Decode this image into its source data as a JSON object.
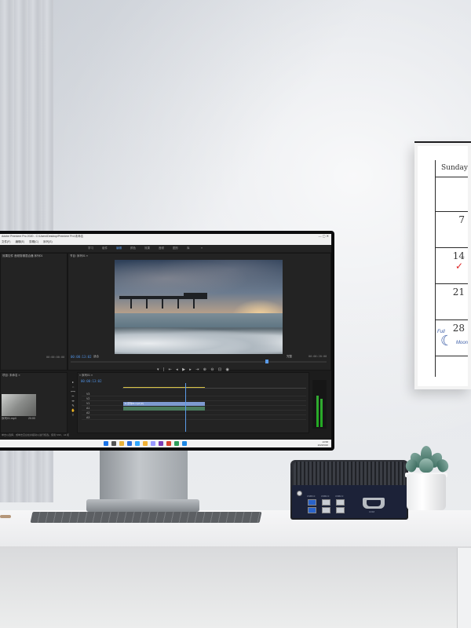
{
  "scene": {
    "description_tags": [
      "desk",
      "monitor",
      "mini-pc",
      "calendar",
      "plant"
    ]
  },
  "calendar": {
    "header": "Sunday",
    "days": [
      "7",
      "14",
      "21",
      "28"
    ],
    "note_text": "Full",
    "note_text2": "Moon"
  },
  "premiere": {
    "title": "Adobe Premiere Pro 2020 - C:\\Users\\Desktop\\Premiere Pro\\未命名",
    "menu": [
      "文件(F)",
      "编辑(E)",
      "剪辑(C)",
      "序列(S)",
      "标记(M)",
      "图形(G)",
      "窗口(W)",
      "帮助(H)"
    ],
    "workspaces": [
      "学习",
      "组件",
      "编辑",
      "颜色",
      "效果",
      "音频",
      "图形",
      "库",
      "»"
    ],
    "source_tab": "效果控件  音频剪辑混合器  序列01",
    "program_tab": "节目: 序列01 ≡",
    "project_tab": "项目: 未命名 ≡",
    "timeline_tab": "× 序列01 ≡",
    "program_timecode": "00:00:13:02",
    "program_fit": "适合",
    "program_quality": "完整",
    "program_duration": "00:00:20:00",
    "source_timecode": "00:00:00:00",
    "source_duration": "00:00:00:00",
    "timeline_timecode": "00:00:13:02",
    "ruler_marks": [
      "00:00",
      "00:00:05:00",
      "00:00:10:00",
      "00:00:15:00",
      "00:00:20:00"
    ],
    "clip_label": "fx 序列01.mp4 [V]",
    "thumbnail_label": "序列01.mp4",
    "thumbnail_duration": "20:00",
    "status_text": "单击以选择，或单击空白处并拖动以进行框选。使用 Shift、Alt 和 Ctrl 可获得其他选项。",
    "track_labels": [
      "V3",
      "V2",
      "V1",
      "A1",
      "A2",
      "A3"
    ],
    "taskbar_time": "13:58",
    "taskbar_date": "2023/6/26"
  },
  "minipc": {
    "port_labels": [
      "USB3.0",
      "USB2.0",
      "USB2.0",
      "COM"
    ]
  },
  "colors": {
    "accent": "#5b9be8",
    "clip_video": "#7e9ad1",
    "clip_audio": "#4a7a5e",
    "pc_body": "#1d1f24",
    "usb3_blue": "#2a63c9"
  }
}
